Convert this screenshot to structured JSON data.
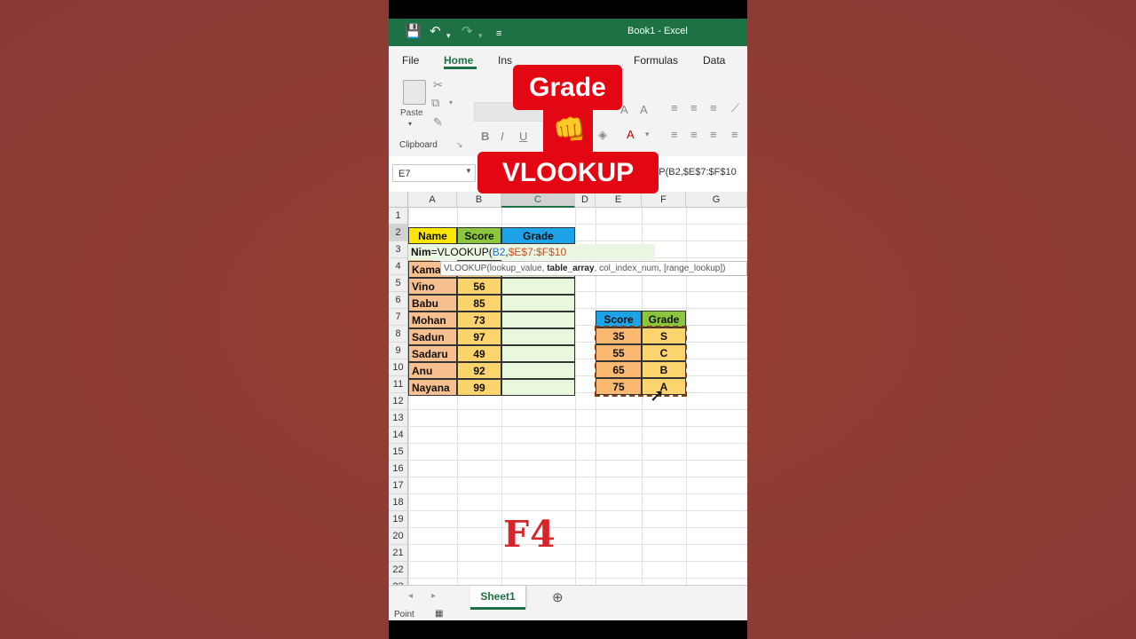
{
  "app": {
    "title": "Book1  -  Excel",
    "accent_color": "#1e7145"
  },
  "menu": {
    "items": [
      "File",
      "Home",
      "Ins",
      "Formulas",
      "Data"
    ],
    "active": "Home"
  },
  "ribbon": {
    "paste_label": "Paste",
    "clipboard_label": "Clipboard",
    "bold": "B",
    "italic": "I",
    "underline": "U"
  },
  "formula_bar": {
    "name_box": "E7",
    "formula": "=VLOOKUP(B2,$E$7:$F$10"
  },
  "sheet": {
    "columns": [
      "A",
      "B",
      "C",
      "D",
      "E",
      "F",
      "G"
    ],
    "rows": [
      "1",
      "2",
      "3",
      "4",
      "5",
      "6",
      "7",
      "8",
      "9",
      "10",
      "11",
      "12",
      "13",
      "14",
      "15",
      "16",
      "17",
      "18",
      "19",
      "20",
      "21",
      "22",
      "23"
    ],
    "headers": {
      "name": "Name",
      "score": "Score",
      "grade": "Grade"
    },
    "students": [
      {
        "name": "Nim",
        "score": ""
      },
      {
        "name": "Kama",
        "score": ""
      },
      {
        "name": "Vino",
        "score": "56"
      },
      {
        "name": "Babu",
        "score": "85"
      },
      {
        "name": "Mohan",
        "score": "73"
      },
      {
        "name": "Sadun",
        "score": "97"
      },
      {
        "name": "Sadaru",
        "score": "49"
      },
      {
        "name": "Anu",
        "score": "92"
      },
      {
        "name": "Nayana",
        "score": "99"
      }
    ],
    "editing_cell": {
      "prefix": "=VLOOKUP(",
      "arg1": "B2",
      "sep": ",",
      "arg2": "$E$7:$F$10"
    },
    "tooltip": {
      "func": "VLOOKUP(",
      "arg1": "lookup_value, ",
      "arg2": "table_array",
      "rest": ", col_index_num, [range_lookup])"
    },
    "lookup_table": {
      "headers": {
        "score": "Score",
        "grade": "Grade"
      },
      "rows": [
        {
          "score": "35",
          "grade": "S"
        },
        {
          "score": "55",
          "grade": "C"
        },
        {
          "score": "65",
          "grade": "B"
        },
        {
          "score": "75",
          "grade": "A"
        }
      ]
    }
  },
  "tabs": {
    "sheet_name": "Sheet1"
  },
  "status": {
    "mode": "Point"
  },
  "overlay": {
    "grade_label": "Grade",
    "vlookup_label": "VLOOKUP",
    "key_label": "F4",
    "fist_icon": "👊"
  }
}
